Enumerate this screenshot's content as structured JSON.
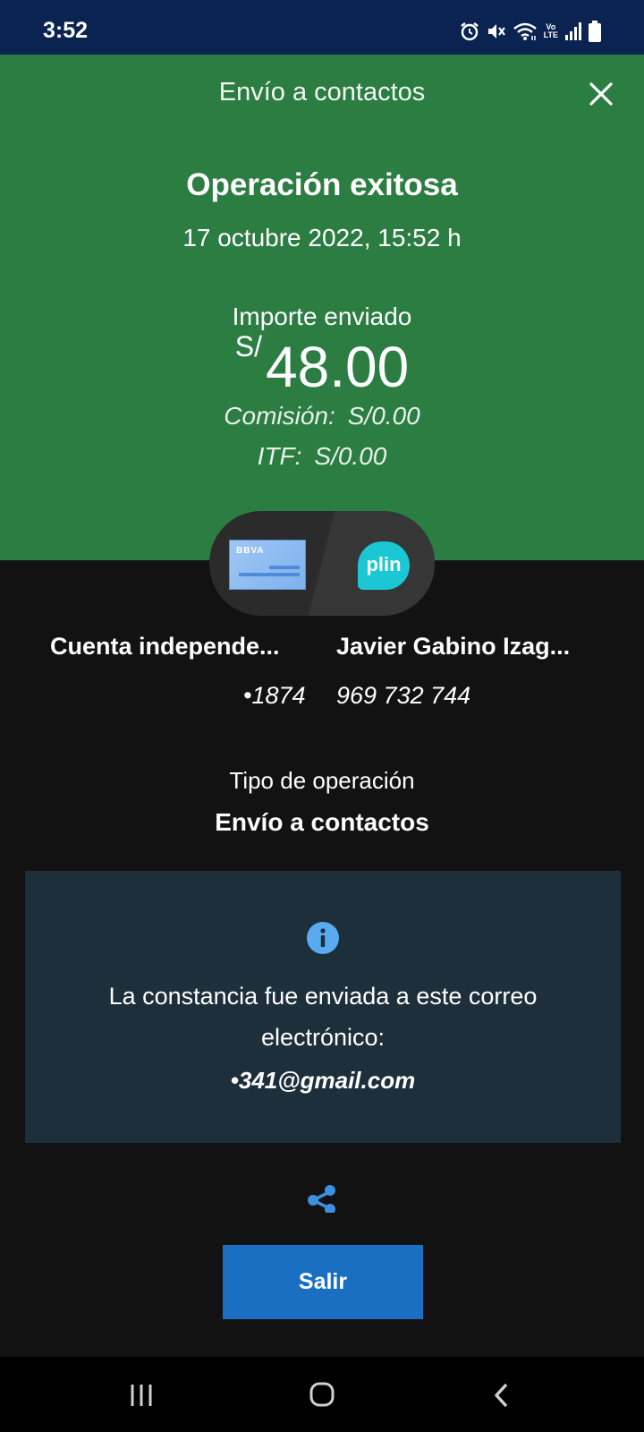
{
  "status_bar": {
    "time": "3:52",
    "volte_top": "Vo",
    "volte_bottom": "LTE",
    "icons": [
      "alarm-icon",
      "mute-icon",
      "wifi-icon",
      "volte-icon",
      "signal-icon",
      "battery-icon"
    ]
  },
  "header": {
    "title": "Envío a contactos",
    "result_title": "Operación exitosa",
    "date": "17 octubre 2022, 15:52 h",
    "amount_label": "Importe enviado",
    "currency": "S/",
    "amount": "48.00",
    "commission_label": "Comisión:",
    "commission_value": "S/0.00",
    "itf_label": "ITF:",
    "itf_value": "S/0.00"
  },
  "transfer": {
    "bank_logo": "BBVA",
    "app_logo": "plin",
    "origin_name": "Cuenta independe...",
    "origin_number": "•1874",
    "destination_name": "Javier Gabino Izag...",
    "destination_number": "969 732 744"
  },
  "operation": {
    "label": "Tipo de operación",
    "value": "Envío a contactos"
  },
  "info": {
    "message": "La constancia fue enviada a este correo electrónico:",
    "email": "•341@gmail.com"
  },
  "actions": {
    "exit_label": "Salir"
  },
  "colors": {
    "header_green": "#2b7d42",
    "status_bar": "#0b2350",
    "background": "#121212",
    "info_box": "#1c2f3b",
    "button_blue": "#1b6fc2",
    "info_icon": "#5aaaf0"
  }
}
